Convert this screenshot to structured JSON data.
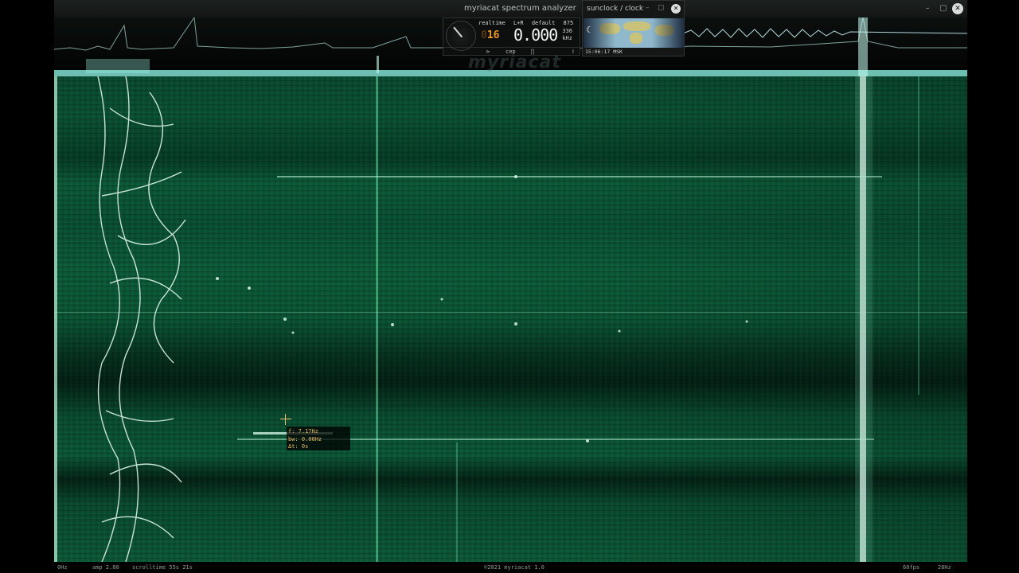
{
  "window": {
    "title": "myriacat spectrum analyzer",
    "minimize": "–",
    "maximize": "▢",
    "close": "✕"
  },
  "player": {
    "mode": "realtime",
    "channels": "L+R",
    "preset": "default",
    "count": "875",
    "track_prefix": "0",
    "track": "16",
    "frequency": "0.000",
    "sub_value": "336",
    "unit": "kHz",
    "buttons": [
      "⊳",
      "cep",
      "∏",
      "ⅰ"
    ]
  },
  "sunclock": {
    "title": "sunclock / clock",
    "minimize": "–",
    "maximize": "▢",
    "close": "✕",
    "moon": "☾",
    "time": "15:06:17 MSK"
  },
  "watermark": "myriacat",
  "cursor_readout": {
    "freq": "f:  7.17Hz",
    "bandwidth": "bw: 0.00Hz",
    "delta_t": "Δt: 0s"
  },
  "status": {
    "low_freq": "0Hz",
    "amp": "amp 2.80",
    "scrolltime": "scrolltime 55s 21s",
    "copyright": "©2021 myriacat 1.0",
    "fps": "60fps",
    "high_freq": "28Hz"
  },
  "colors": {
    "waterfall": "#0b5535",
    "signal": "#dfffee",
    "accent": "#f29a1e"
  }
}
